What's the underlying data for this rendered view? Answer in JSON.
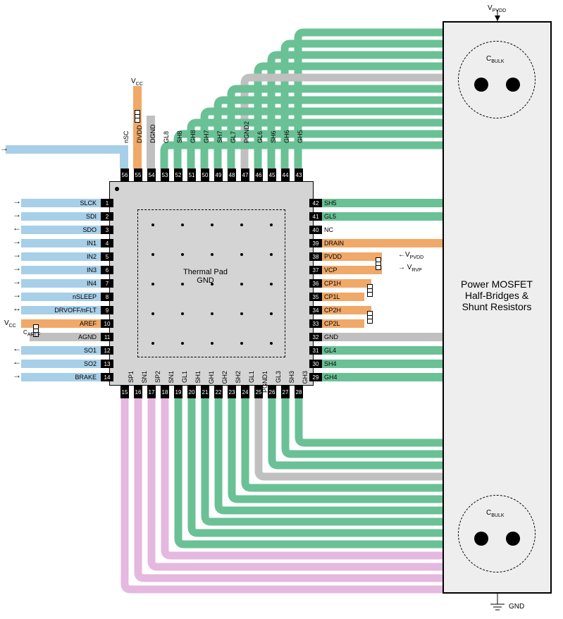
{
  "power": {
    "vcc": "V",
    "vcc_sub": "CC",
    "vpvdd": "V",
    "vpvdd_sub": "PVDD",
    "vrvp": "V",
    "vrvp_sub": "RVP",
    "gnd": "GND"
  },
  "caref": "C",
  "caref_sub": "AREF",
  "cbulk": "C",
  "cbulk_sub": "BULK",
  "thermal": {
    "line1": "Thermal Pad",
    "line2": "GND"
  },
  "power_box": {
    "line1": "Power MOSFET",
    "line2": "Half-Bridges &",
    "line3": "Shunt Resistors"
  },
  "pins_left": [
    {
      "n": "1",
      "name": "SLCK"
    },
    {
      "n": "2",
      "name": "SDI"
    },
    {
      "n": "3",
      "name": "SDO"
    },
    {
      "n": "4",
      "name": "IN1"
    },
    {
      "n": "5",
      "name": "IN2"
    },
    {
      "n": "6",
      "name": "IN3"
    },
    {
      "n": "7",
      "name": "IN4"
    },
    {
      "n": "8",
      "name": "nSLEEP"
    },
    {
      "n": "9",
      "name": "DRVOFF/nFLT"
    },
    {
      "n": "10",
      "name": "AREF"
    },
    {
      "n": "11",
      "name": "AGND"
    },
    {
      "n": "12",
      "name": "SO1"
    },
    {
      "n": "13",
      "name": "SO2"
    },
    {
      "n": "14",
      "name": "BRAKE"
    }
  ],
  "pins_bottom": [
    {
      "n": "15",
      "name": "SP1"
    },
    {
      "n": "16",
      "name": "SN1"
    },
    {
      "n": "17",
      "name": "SP2"
    },
    {
      "n": "18",
      "name": "SN1"
    },
    {
      "n": "19",
      "name": "GL1"
    },
    {
      "n": "20",
      "name": "SH1"
    },
    {
      "n": "21",
      "name": "GH1"
    },
    {
      "n": "22",
      "name": "GH2"
    },
    {
      "n": "23",
      "name": "SH2"
    },
    {
      "n": "24",
      "name": "GL1"
    },
    {
      "n": "25",
      "name": "PGND1"
    },
    {
      "n": "26",
      "name": "GL3"
    },
    {
      "n": "27",
      "name": "SH3"
    },
    {
      "n": "28",
      "name": "GH3"
    }
  ],
  "pins_right": [
    {
      "n": "29",
      "name": "GH4"
    },
    {
      "n": "30",
      "name": "SH4"
    },
    {
      "n": "31",
      "name": "GL4"
    },
    {
      "n": "32",
      "name": "GND"
    },
    {
      "n": "33",
      "name": "CP2L"
    },
    {
      "n": "34",
      "name": "CP2H"
    },
    {
      "n": "35",
      "name": "CP1L"
    },
    {
      "n": "36",
      "name": "CP1H"
    },
    {
      "n": "37",
      "name": "VCP"
    },
    {
      "n": "38",
      "name": "PVDD"
    },
    {
      "n": "39",
      "name": "DRAIN"
    },
    {
      "n": "40",
      "name": "NC"
    },
    {
      "n": "41",
      "name": "GL5"
    },
    {
      "n": "42",
      "name": "SH5"
    }
  ],
  "pins_top": [
    {
      "n": "43",
      "name": "GH5"
    },
    {
      "n": "44",
      "name": "GH6"
    },
    {
      "n": "45",
      "name": "SH6"
    },
    {
      "n": "46",
      "name": "GL6"
    },
    {
      "n": "47",
      "name": "PGND2"
    },
    {
      "n": "48",
      "name": "GL7"
    },
    {
      "n": "49",
      "name": "SH7"
    },
    {
      "n": "50",
      "name": "GH7"
    },
    {
      "n": "51",
      "name": "GH8"
    },
    {
      "n": "52",
      "name": "SH8"
    },
    {
      "n": "53",
      "name": "GL8"
    },
    {
      "n": "54",
      "name": "DGND"
    },
    {
      "n": "55",
      "name": "DVDD"
    },
    {
      "n": "56",
      "name": "nSC"
    }
  ],
  "colors": {
    "blue": "#a7cfe8",
    "green": "#6ac195",
    "orange": "#f0a968",
    "pink": "#e5b8e0",
    "grey": "#c0c0c0"
  }
}
